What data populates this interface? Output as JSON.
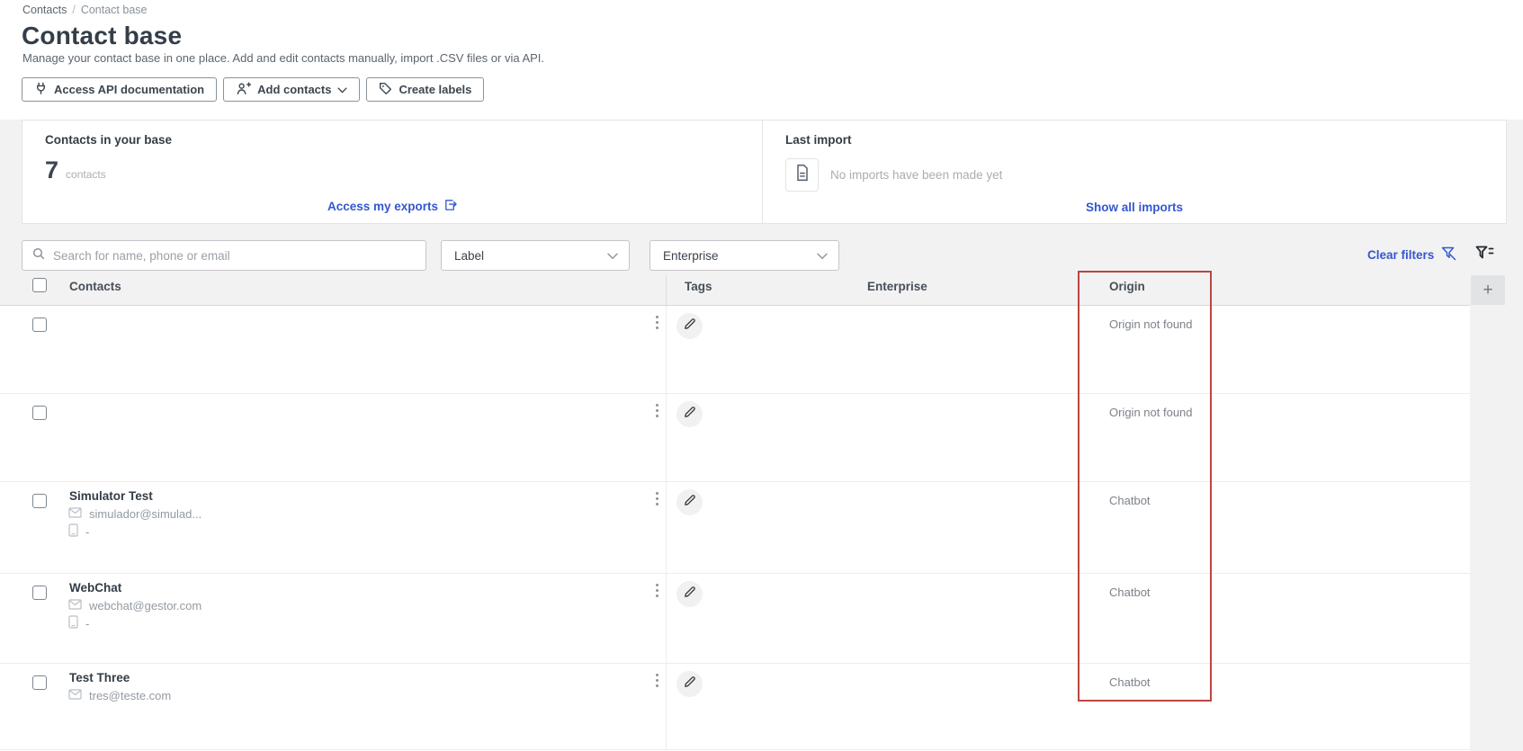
{
  "breadcrumb": {
    "items": [
      "Contacts",
      "Contact base"
    ],
    "separator": "/"
  },
  "header": {
    "title": "Contact base",
    "subtitle": "Manage your contact base in one place. Add and edit contacts manually, import .CSV files or via API.",
    "buttons": {
      "api_label": "Access API documentation",
      "add_label": "Add contacts",
      "labels_label": "Create labels"
    }
  },
  "summary": {
    "contacts_card": {
      "title": "Contacts in your base",
      "count": "7",
      "unit": "contacts",
      "link_label": "Access my exports"
    },
    "import_card": {
      "title": "Last import",
      "empty_message": "No imports have been made yet",
      "link_label": "Show all imports"
    }
  },
  "filters": {
    "search_placeholder": "Search for name, phone or email",
    "label_filter_value": "Label",
    "enterprise_filter_value": "Enterprise",
    "clear_label": "Clear filters"
  },
  "table": {
    "columns": {
      "contacts": "Contacts",
      "tags": "Tags",
      "enterprise": "Enterprise",
      "origin": "Origin"
    },
    "add_column_label": "+",
    "rows": [
      {
        "name": "",
        "email": "",
        "phone": "",
        "origin": "Origin not found"
      },
      {
        "name": "",
        "email": "",
        "phone": "",
        "origin": "Origin not found"
      },
      {
        "name": "Simulator Test",
        "email": "simulador@simulad...",
        "phone": "-",
        "origin": "Chatbot"
      },
      {
        "name": "WebChat",
        "email": "webchat@gestor.com",
        "phone": "-",
        "origin": "Chatbot"
      },
      {
        "name": "Test Three",
        "email": "tres@teste.com",
        "phone": "",
        "origin": "Chatbot"
      }
    ]
  },
  "colors": {
    "accent_blue": "#3557cf",
    "highlight_red": "#bc4641",
    "title_dark": "#333e48"
  }
}
